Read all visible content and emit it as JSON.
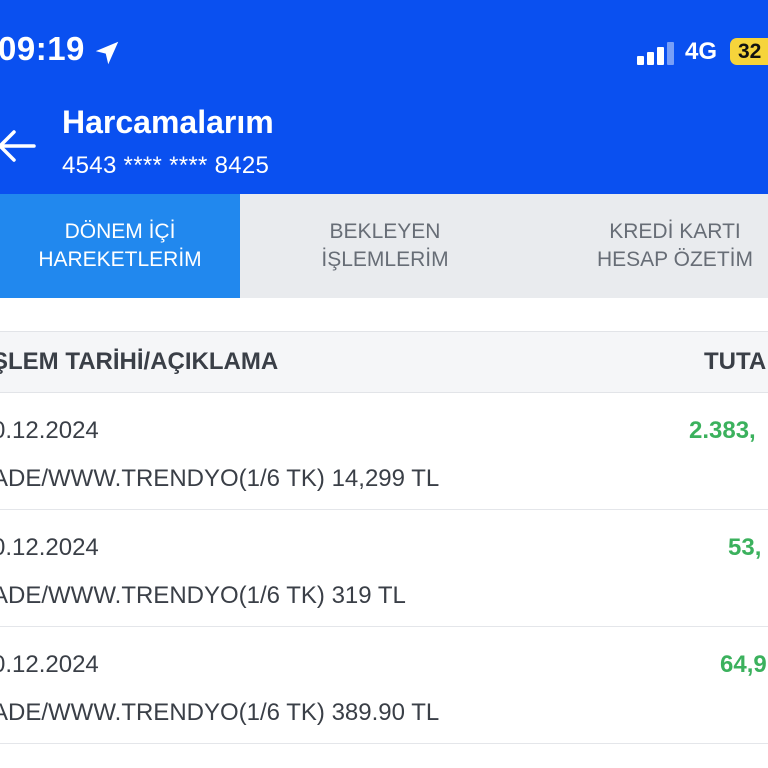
{
  "status_bar": {
    "time": "09:19",
    "network": "4G",
    "battery": "32"
  },
  "header": {
    "title": "Harcamalarım",
    "card_number": "4543 **** **** 8425"
  },
  "tabs": [
    {
      "line1": "DÖNEM İÇİ",
      "line2": "HAREKETLERİM",
      "active": true
    },
    {
      "line1": "BEKLEYEN",
      "line2": "İŞLEMLERİM",
      "active": false
    },
    {
      "line1": "KREDİ KARTI",
      "line2": "HESAP ÖZETİM",
      "active": false
    }
  ],
  "columns": {
    "left": "ŞLEM TARİHİ/AÇIKLAMA",
    "right": "TUTA"
  },
  "transactions": [
    {
      "date": "0.12.2024",
      "description": "ADE/WWW.TRENDYO(1/6 TK)  14,299 TL",
      "amount": "2.383,"
    },
    {
      "date": "0.12.2024",
      "description": "ADE/WWW.TRENDYO(1/6 TK)  319 TL",
      "amount": "53,"
    },
    {
      "date": "0.12.2024",
      "description": "ADE/WWW.TRENDYO(1/6 TK)  389.90 TL",
      "amount": "64,9"
    }
  ],
  "colors": {
    "header_bg": "#0a50f0",
    "active_tab": "#2188ee",
    "amount_green": "#3bb15d"
  },
  "icons": [
    "location-arrow-icon",
    "signal-icon",
    "battery-icon",
    "back-arrow-icon"
  ]
}
